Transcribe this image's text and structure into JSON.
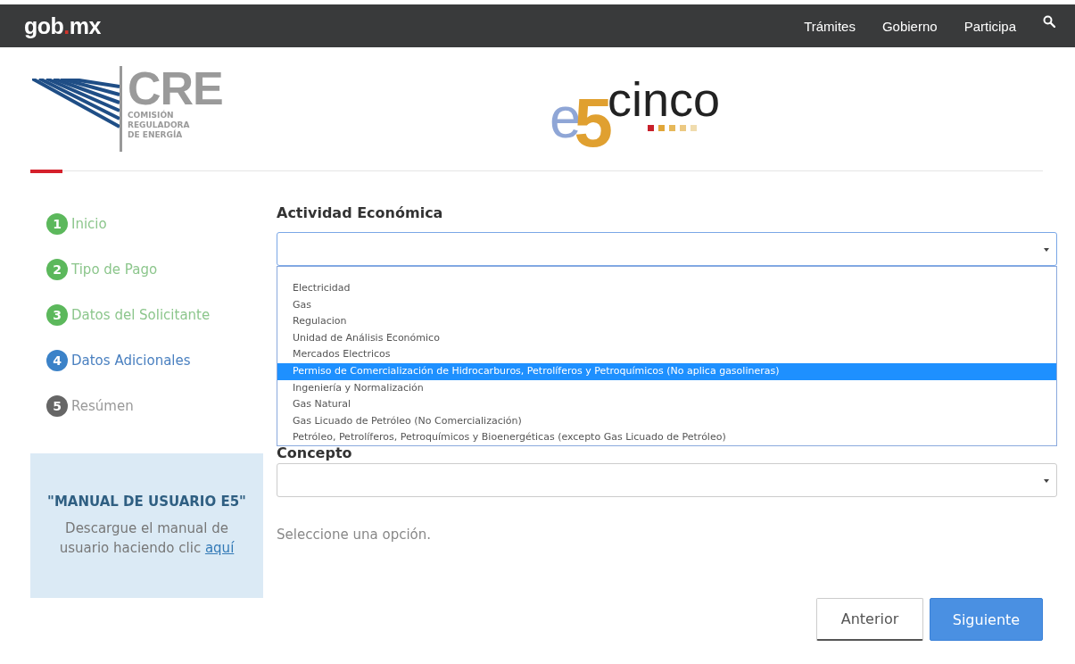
{
  "navbar": {
    "brand": [
      {
        "text": "gob",
        "accent": false
      },
      {
        "text": ".",
        "accent": true
      },
      {
        "text": "mx",
        "accent": false
      }
    ],
    "links": [
      "Trámites",
      "Gobierno",
      "Participa"
    ]
  },
  "header": {
    "cre_logo": {
      "acronym": "CRE",
      "lines": [
        "COMISIÓN",
        "REGULADORA",
        "DE ENERGÍA"
      ]
    },
    "e5_logo": {
      "letter": "e",
      "digit": "5",
      "word": "cinco"
    }
  },
  "steps": [
    {
      "number": "1",
      "label": "Inicio",
      "kind": "done"
    },
    {
      "number": "2",
      "label": "Tipo de Pago",
      "kind": "done"
    },
    {
      "number": "3",
      "label": "Datos del Solicitante",
      "kind": "done"
    },
    {
      "number": "4",
      "label": "Datos Adicionales",
      "kind": "current"
    },
    {
      "number": "5",
      "label": "Resúmen",
      "kind": "pending"
    }
  ],
  "manual_box": {
    "title": "\"MANUAL DE USUARIO E5\"",
    "text": "Descargue el manual de usuario haciendo clic",
    "link": "aquí"
  },
  "form": {
    "activity": {
      "label": "Actividad Económica",
      "expanded": true,
      "options": [
        {
          "label": "Electricidad",
          "selected": false
        },
        {
          "label": "Gas",
          "selected": false
        },
        {
          "label": "Regulacion",
          "selected": false
        },
        {
          "label": "Unidad de Análisis Económico",
          "selected": false
        },
        {
          "label": "Mercados Electricos",
          "selected": false
        },
        {
          "label": "Permiso de Comercialización de Hidrocarburos, Petrolíferos y Petroquímicos (No aplica gasolineras)",
          "selected": true
        },
        {
          "label": "Ingeniería y Normalización",
          "selected": false
        },
        {
          "label": "Gas Natural",
          "selected": false
        },
        {
          "label": "Gas Licuado de Petróleo (No Comercialización)",
          "selected": false
        },
        {
          "label": "Petróleo, Petrolíferos, Petroquímicos y Bioenergéticas (excepto Gas Licuado de Petróleo)",
          "selected": false
        }
      ]
    },
    "concept": {
      "label": "Concepto"
    },
    "hint": "Seleccione una opción.",
    "buttons": [
      {
        "label": "Anterior",
        "kind": "secondary"
      },
      {
        "label": "Siguiente",
        "kind": "primary"
      }
    ]
  }
}
